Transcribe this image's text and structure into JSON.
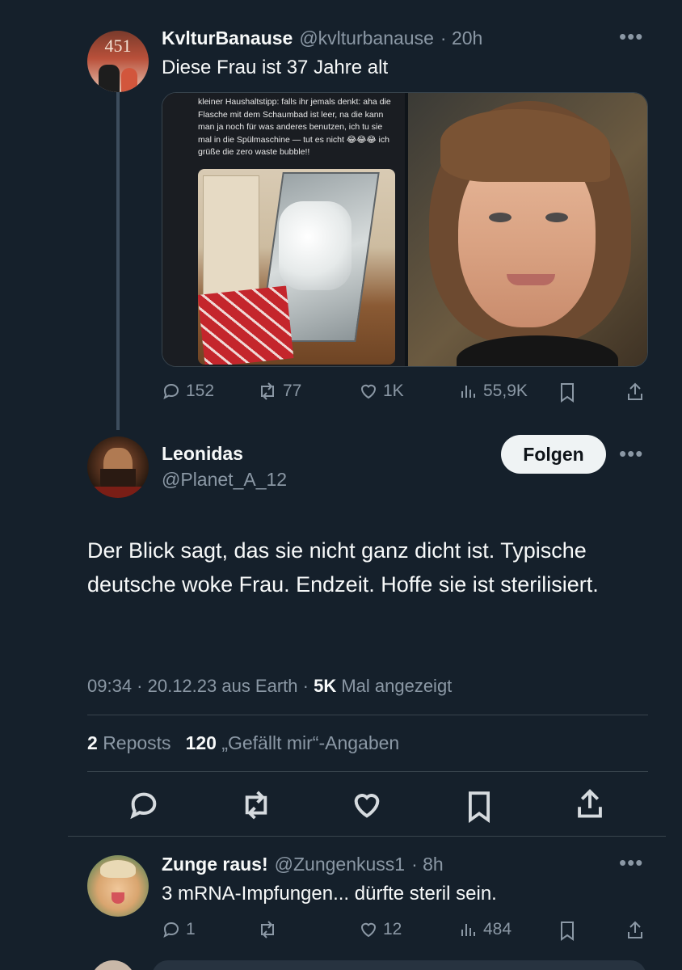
{
  "quoted_tweet": {
    "display_name": "KvlturBanause",
    "handle": "@kvlturbanause",
    "time": "· 20h",
    "text": "Diese Frau ist 37 Jahre alt",
    "avatar_text": "451",
    "image_left_text": "kleiner Haushaltstipp: falls ihr jemals denkt: aha die Flasche mit dem Schaumbad ist leer, na die kann man ja noch für was anderes benutzen, ich tu sie mal in die Spülmaschine — tut es nicht 😂😂😂 ich grüße die zero waste bubble!!",
    "actions": {
      "replies": "152",
      "reposts": "77",
      "likes": "1K",
      "views": "55,9K"
    }
  },
  "main_tweet": {
    "display_name": "Leonidas",
    "handle": "@Planet_A_12",
    "follow_label": "Folgen",
    "text": "Der Blick sagt, das sie nicht ganz dicht ist. Typische deutsche woke Frau. Endzeit. Hoffe sie ist sterilisiert.",
    "meta_time": "09:34 · 20.12.23 aus Earth · ",
    "meta_views_count": "5K",
    "meta_views_label": " Mal angezeigt",
    "reposts_count": "2",
    "reposts_label": "Reposts",
    "likes_count": "120",
    "likes_label": "„Gefällt mir“-Angaben"
  },
  "reply_tweet": {
    "display_name": "Zunge raus!",
    "handle": "@Zungenkuss1",
    "time": "· 8h",
    "text": "3 mRNA-Impfungen... dürfte steril sein.",
    "actions": {
      "replies": "1",
      "reposts": "",
      "likes": "12",
      "views": "484"
    }
  },
  "colors": {
    "background": "#15202b",
    "text": "#f7f9f9",
    "muted": "#8b98a5",
    "divider": "#38444d"
  },
  "icons": [
    "more-icon",
    "reply-icon",
    "repost-icon",
    "like-icon",
    "views-icon",
    "bookmark-icon",
    "share-icon"
  ]
}
